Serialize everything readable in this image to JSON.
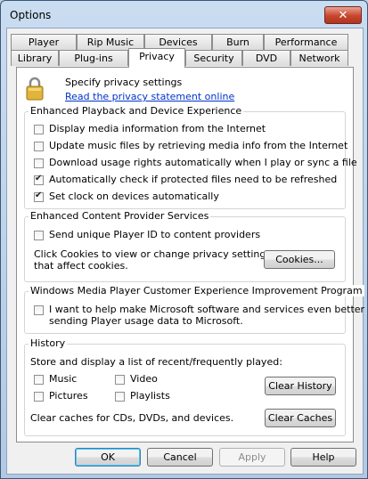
{
  "window": {
    "title": "Options"
  },
  "tabs": {
    "row1": [
      "Player",
      "Rip Music",
      "Devices",
      "Burn",
      "Performance"
    ],
    "row2": [
      "Library",
      "Plug-ins",
      "Privacy",
      "Security",
      "DVD",
      "Network"
    ],
    "active": "Privacy"
  },
  "privacy": {
    "specify_label": "Specify privacy settings",
    "statement_link": "Read the privacy statement online"
  },
  "enhanced_playback": {
    "title": "Enhanced Playback and Device Experience",
    "items": [
      {
        "label": "Display media information from the Internet",
        "checked": false
      },
      {
        "label": "Update music files by retrieving media info from the Internet",
        "checked": false
      },
      {
        "label": "Download usage rights automatically when I play or sync a file",
        "checked": false
      },
      {
        "label": "Automatically check if protected files need to be refreshed",
        "checked": true
      },
      {
        "label": "Set clock on devices automatically",
        "checked": true
      }
    ]
  },
  "provider_services": {
    "title": "Enhanced Content Provider Services",
    "send_id_label": "Send unique Player ID to content providers",
    "cookies_text_1": "Click Cookies to view or change privacy settings",
    "cookies_text_2": "that affect cookies.",
    "cookies_button": "Cookies..."
  },
  "ceip": {
    "title": "Windows Media Player Customer Experience Improvement Program",
    "text_1": "I want to help make Microsoft software and services even better by",
    "text_2": "sending Player usage data to Microsoft."
  },
  "history": {
    "title": "History",
    "store_label": "Store and display a list of recent/frequently played:",
    "music": "Music",
    "video": "Video",
    "pictures": "Pictures",
    "playlists": "Playlists",
    "clear_history_button": "Clear History",
    "clear_caches_text": "Clear caches for CDs, DVDs, and devices.",
    "clear_caches_button": "Clear Caches"
  },
  "buttons": {
    "ok": "OK",
    "cancel": "Cancel",
    "apply": "Apply",
    "help": "Help"
  }
}
